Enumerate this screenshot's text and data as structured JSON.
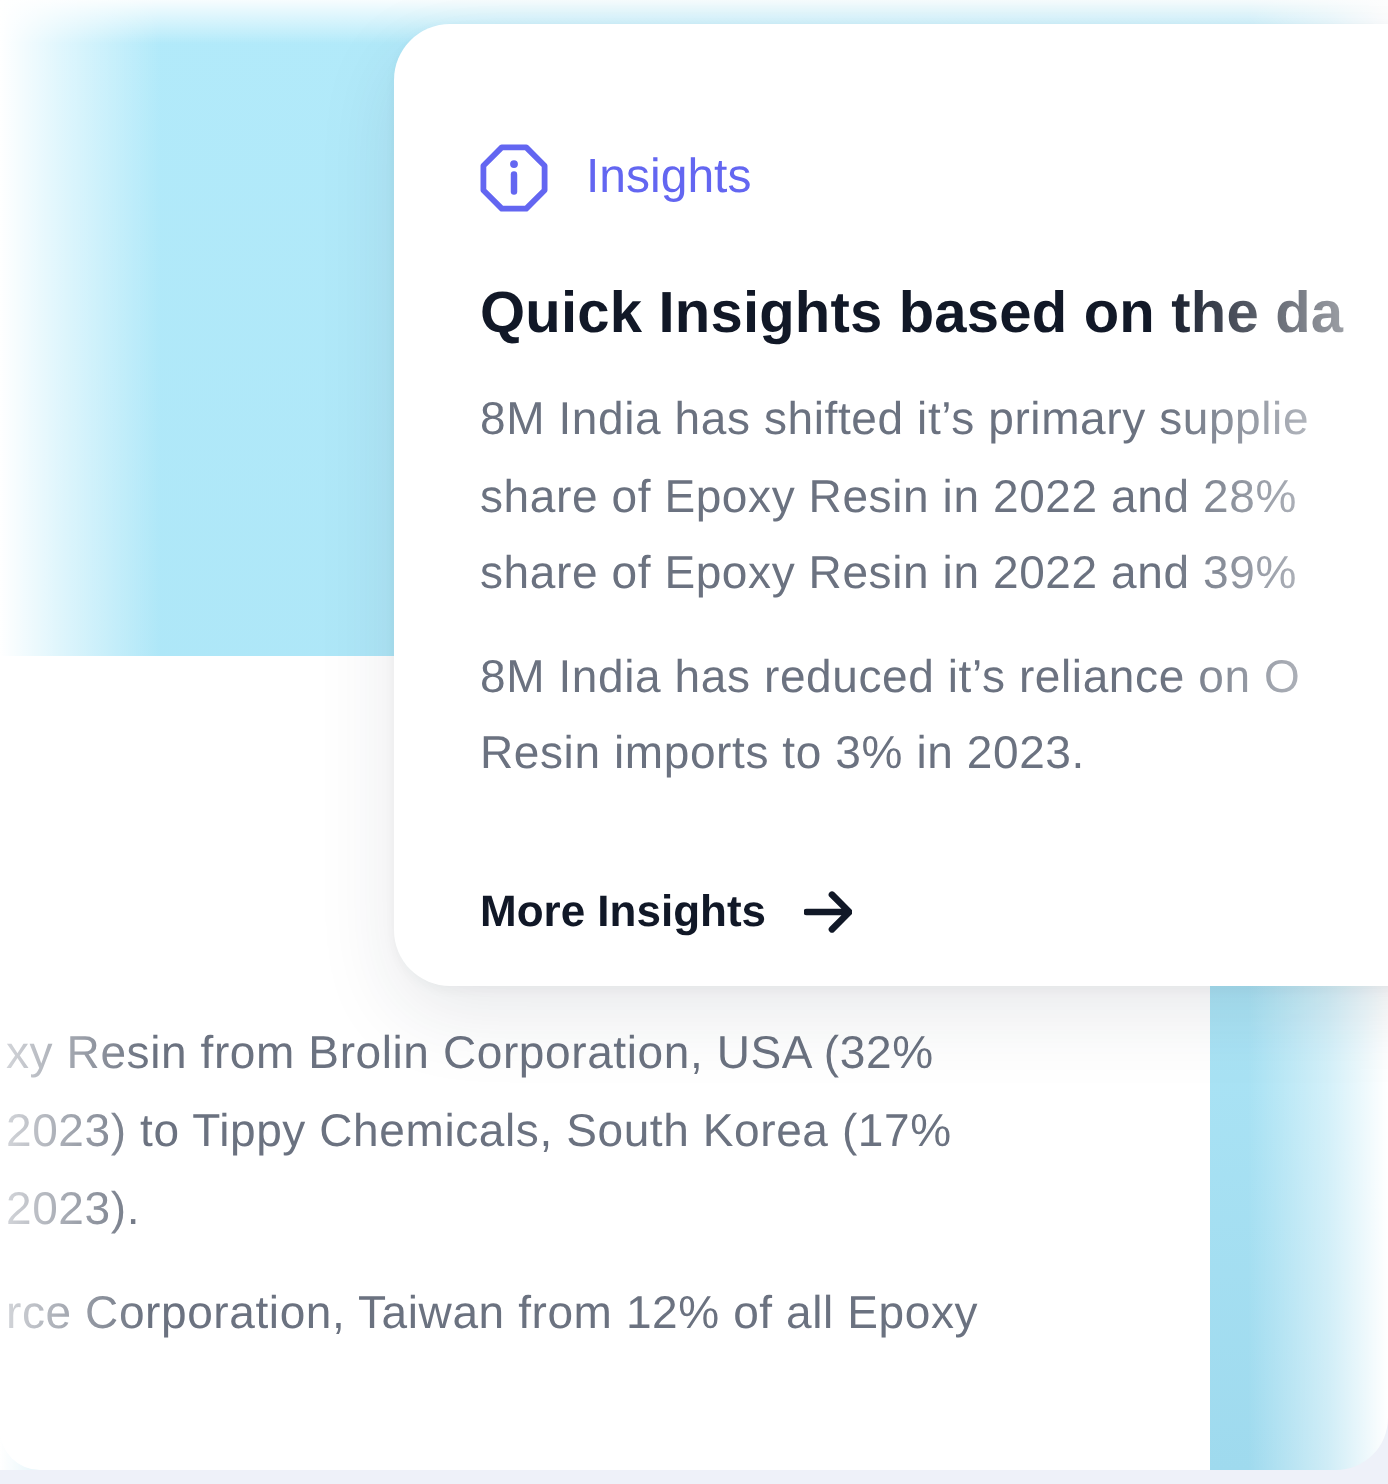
{
  "insights_card": {
    "label": "Insights",
    "title": "Quick Insights based on the da",
    "paragraphs": [
      {
        "lines": [
          "8M India has shifted it’s primary supplie",
          "share of Epoxy Resin in 2022 and 28%",
          "share of Epoxy Resin in 2022 and 39%"
        ]
      },
      {
        "lines": [
          "8M India has reduced it’s reliance on O",
          "Resin imports to 3% in 2023."
        ]
      }
    ],
    "link": "More Insights"
  },
  "summary_card": {
    "paragraphs": [
      {
        "lines": [
          "xy Resin from Brolin Corporation, USA (32%",
          "2023) to Tippy Chemicals, South Korea (17%",
          "2023)."
        ]
      },
      {
        "lines": [
          "rce Corporation, Taiwan from 12% of all Epoxy"
        ]
      }
    ]
  }
}
